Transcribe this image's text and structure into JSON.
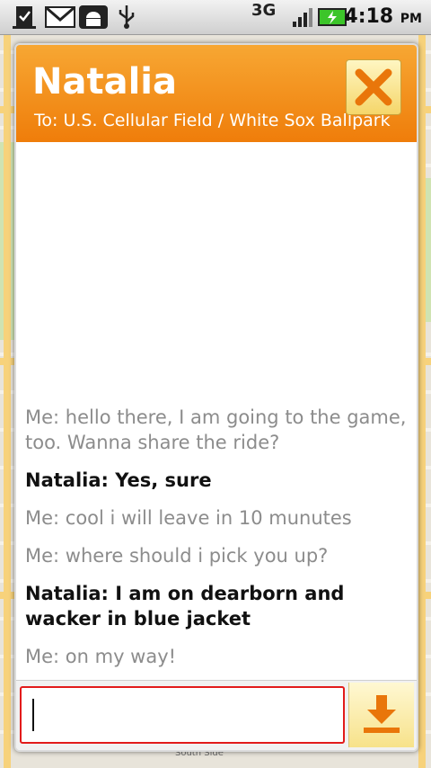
{
  "status_bar": {
    "network": "3G",
    "time": "4:18",
    "ampm": "PM",
    "icons": [
      "checklist-icon",
      "gmail-icon",
      "android-debug-icon",
      "usb-icon",
      "signal-icon",
      "battery-charging-icon"
    ]
  },
  "map": {
    "labels": [
      "South Side"
    ]
  },
  "dialog": {
    "contact_name": "Natalia",
    "to_line": "To: U.S. Cellular Field / White Sox Ballpark",
    "close_icon": "close-icon",
    "messages": [
      {
        "sender": "me",
        "text": "Me: hello there, I am going to the game, too. Wanna share the ride?"
      },
      {
        "sender": "them",
        "text": "Natalia: Yes, sure"
      },
      {
        "sender": "me",
        "text": "Me: cool i will leave in 10 munutes"
      },
      {
        "sender": "me",
        "text": "Me: where should i pick you up?"
      },
      {
        "sender": "them",
        "text": "Natalia: I am on dearborn and wacker in blue jacket"
      },
      {
        "sender": "me",
        "text": "Me: on my way!"
      }
    ],
    "input_value": "",
    "send_icon": "send-download-icon"
  },
  "colors": {
    "header_top": "#f7a733",
    "header_bottom": "#ef7d0a",
    "input_border": "#e21b1b",
    "icon_orange": "#e9760a"
  }
}
